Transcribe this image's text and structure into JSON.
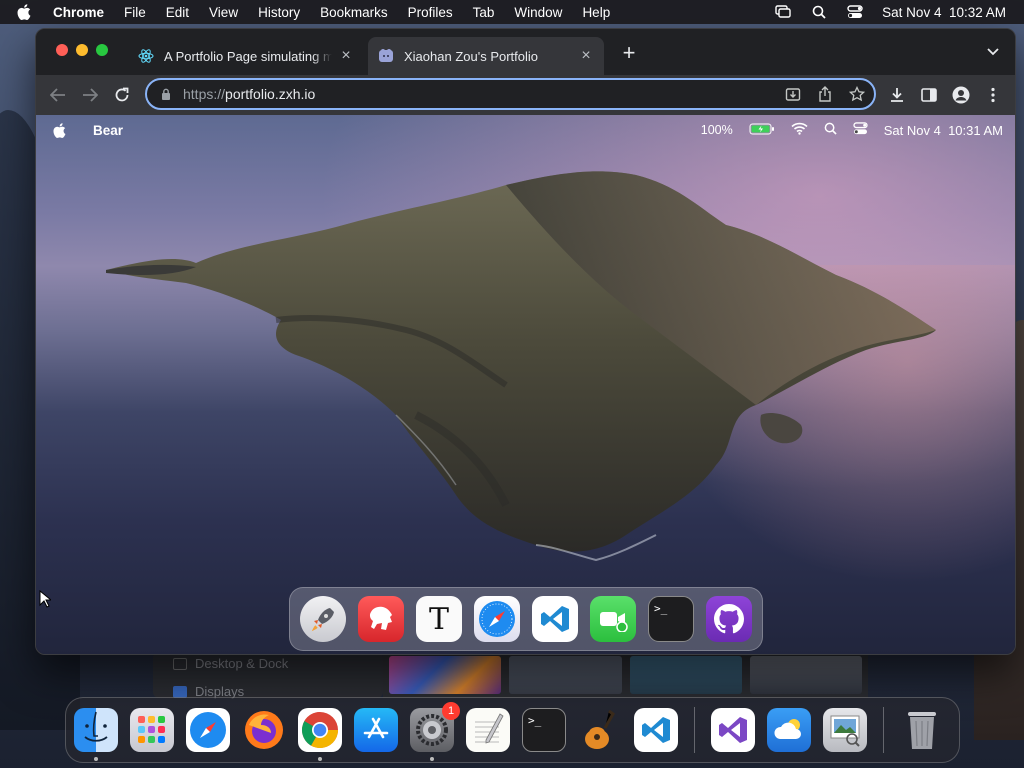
{
  "menubar": {
    "app_name": "Chrome",
    "menus": [
      "File",
      "Edit",
      "View",
      "History",
      "Bookmarks",
      "Profiles",
      "Tab",
      "Window",
      "Help"
    ],
    "datetime": "Sat Nov 4  10:32 AM"
  },
  "background": {
    "settings_items": [
      "Desktop & Dock",
      "Displays"
    ]
  },
  "browser": {
    "tabs": [
      {
        "title": "A Portfolio Page simulating macOS",
        "favicon": "react-icon",
        "active": false
      },
      {
        "title": "Xiaohan Zou's Portfolio",
        "favicon": "bear-icon",
        "active": true
      }
    ],
    "url_scheme": "https://",
    "url_host": "portfolio.zxh.io"
  },
  "simulated_os": {
    "menubar": {
      "app_name": "Bear",
      "battery": "100%",
      "datetime": "Sat Nov 4  10:31 AM"
    },
    "dock_apps": [
      "launchpad-icon",
      "bear-app-icon",
      "typora-icon",
      "safari-icon",
      "vscode-icon",
      "facetime-icon",
      "terminal-icon",
      "github-icon"
    ]
  },
  "dock": {
    "apps": [
      {
        "name": "finder-icon",
        "running": true
      },
      {
        "name": "launchpad-icon",
        "running": false
      },
      {
        "name": "safari-icon",
        "running": false
      },
      {
        "name": "firefox-icon",
        "running": false
      },
      {
        "name": "chrome-icon",
        "running": true
      },
      {
        "name": "app-store-icon",
        "running": false
      },
      {
        "name": "system-settings-icon",
        "running": true,
        "badge": "1"
      },
      {
        "name": "textedit-icon",
        "running": false
      },
      {
        "name": "terminal-icon",
        "running": false
      },
      {
        "name": "garageband-icon",
        "running": false
      },
      {
        "name": "vscode-icon",
        "running": false
      },
      {
        "name": "visual-studio-icon",
        "running": false
      },
      {
        "name": "weather-icon",
        "running": false
      },
      {
        "name": "preview-icon",
        "running": false
      },
      {
        "name": "trash-icon",
        "running": false
      }
    ]
  }
}
